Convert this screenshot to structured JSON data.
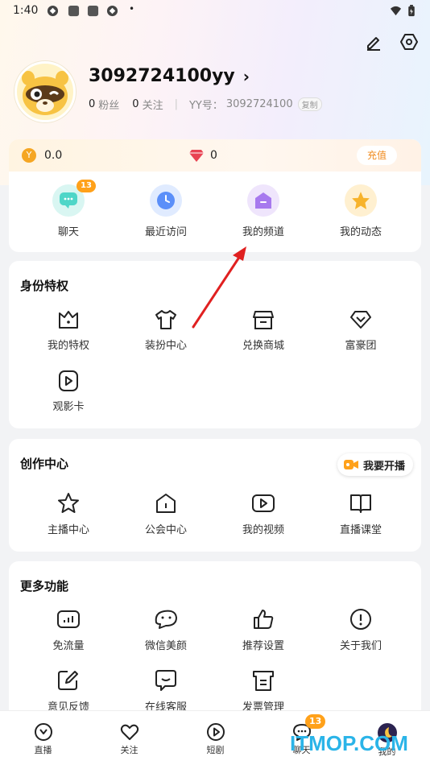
{
  "status_bar": {
    "time": "1:40"
  },
  "profile": {
    "username": "3092724100yy",
    "fans_count": "0",
    "fans_label": "粉丝",
    "follow_count": "0",
    "follow_label": "关注",
    "yy_label": "YY号：",
    "yy_id": "3092724100",
    "copy_label": "复制"
  },
  "wallet": {
    "coin_value": "0.0",
    "gem_value": "0",
    "recharge_label": "充值"
  },
  "shortcuts": [
    {
      "label": "聊天",
      "icon": "chat-icon",
      "badge": "13",
      "color": "#4fd6c8"
    },
    {
      "label": "最近访问",
      "icon": "clock-icon",
      "color": "#5b8ff9"
    },
    {
      "label": "我的频道",
      "icon": "channel-icon",
      "color": "#a779ee"
    },
    {
      "label": "我的动态",
      "icon": "star-icon",
      "color": "#f7b32b"
    }
  ],
  "identity": {
    "title": "身份特权",
    "items": [
      {
        "label": "我的特权",
        "icon": "crown-icon"
      },
      {
        "label": "装扮中心",
        "icon": "shirt-icon"
      },
      {
        "label": "兑换商城",
        "icon": "store-icon"
      },
      {
        "label": "富豪团",
        "icon": "diamond-icon"
      },
      {
        "label": "观影卡",
        "icon": "movie-card-icon"
      }
    ]
  },
  "creator": {
    "title": "创作中心",
    "live_button": "我要开播",
    "items": [
      {
        "label": "主播中心",
        "icon": "star-outline-icon"
      },
      {
        "label": "公会中心",
        "icon": "guild-icon"
      },
      {
        "label": "我的视频",
        "icon": "video-icon"
      },
      {
        "label": "直播课堂",
        "icon": "book-icon"
      }
    ]
  },
  "more": {
    "title": "更多功能",
    "items": [
      {
        "label": "免流量",
        "icon": "data-free-icon"
      },
      {
        "label": "微信美颜",
        "icon": "beauty-icon"
      },
      {
        "label": "推荐设置",
        "icon": "thumbs-up-icon"
      },
      {
        "label": "关于我们",
        "icon": "info-icon"
      },
      {
        "label": "意见反馈",
        "icon": "feedback-icon"
      },
      {
        "label": "在线客服",
        "icon": "service-icon"
      },
      {
        "label": "发票管理",
        "icon": "invoice-icon"
      }
    ]
  },
  "tabs": [
    {
      "label": "直播",
      "icon": "live-tab-icon"
    },
    {
      "label": "关注",
      "icon": "heart-icon"
    },
    {
      "label": "短剧",
      "icon": "play-icon"
    },
    {
      "label": "聊天",
      "icon": "chat-tab-icon",
      "badge": "13"
    },
    {
      "label": "我的",
      "icon": "avatar-tab-icon"
    }
  ],
  "watermark": "ITMOP.COM",
  "colors": {
    "accent_orange": "#ffa11a",
    "annotation_arrow": "#e02020",
    "watermark": "#2ab4e8"
  }
}
